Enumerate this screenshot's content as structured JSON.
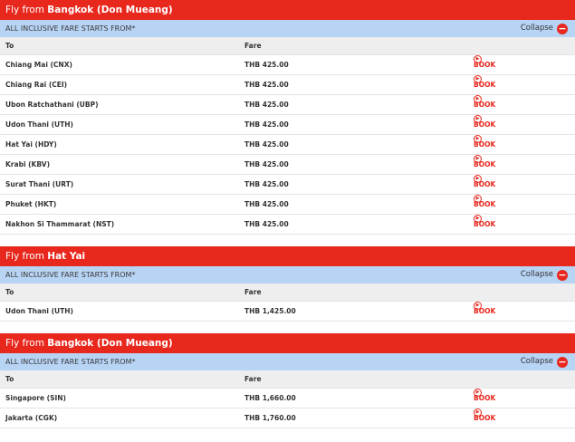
{
  "sections": [
    {
      "prefix": "Fly from ",
      "city": "Bangkok (Don Mueang)",
      "subheader": "ALL INCLUSIVE FARE STARTS FROM*",
      "collapse": "Collapse",
      "col_to": "To",
      "col_fare": "Fare",
      "rows": [
        {
          "to": "Chiang Mai (CNX)",
          "fare": "THB 425.00",
          "book": "BOOK"
        },
        {
          "to": "Chiang Rai (CEI)",
          "fare": "THB 425.00",
          "book": "BOOK"
        },
        {
          "to": "Ubon Ratchathani (UBP)",
          "fare": "THB 425.00",
          "book": "BOOK"
        },
        {
          "to": "Udon Thani (UTH)",
          "fare": "THB 425.00",
          "book": "BOOK"
        },
        {
          "to": "Hat Yai (HDY)",
          "fare": "THB 425.00",
          "book": "BOOK"
        },
        {
          "to": "Krabi (KBV)",
          "fare": "THB 425.00",
          "book": "BOOK"
        },
        {
          "to": "Surat Thani (URT)",
          "fare": "THB 425.00",
          "book": "BOOK"
        },
        {
          "to": "Phuket (HKT)",
          "fare": "THB 425.00",
          "book": "BOOK"
        },
        {
          "to": "Nakhon Si Thammarat (NST)",
          "fare": "THB 425.00",
          "book": "BOOK"
        }
      ]
    },
    {
      "prefix": "Fly from ",
      "city": "Hat Yai",
      "subheader": "ALL INCLUSIVE FARE STARTS FROM*",
      "collapse": "Collapse",
      "col_to": "To",
      "col_fare": "Fare",
      "rows": [
        {
          "to": "Udon Thani (UTH)",
          "fare": "THB 1,425.00",
          "book": "BOOK"
        }
      ]
    },
    {
      "prefix": "Fly from ",
      "city": "Bangkok (Don Mueang)",
      "subheader": "ALL INCLUSIVE FARE STARTS FROM*",
      "collapse": "Collapse",
      "col_to": "To",
      "col_fare": "Fare",
      "rows": [
        {
          "to": "Singapore (SIN)",
          "fare": "THB 1,660.00",
          "book": "BOOK"
        },
        {
          "to": "Jakarta (CGK)",
          "fare": "THB 1,760.00",
          "book": "BOOK"
        }
      ]
    }
  ],
  "colors": {
    "brand_red": "#e8271d",
    "subheader_blue": "#b8d4f5",
    "column_header_gray": "#eeeeee"
  },
  "icons": {
    "collapse": "minus-circle-icon",
    "book": "arrow-right-circle-icon"
  }
}
